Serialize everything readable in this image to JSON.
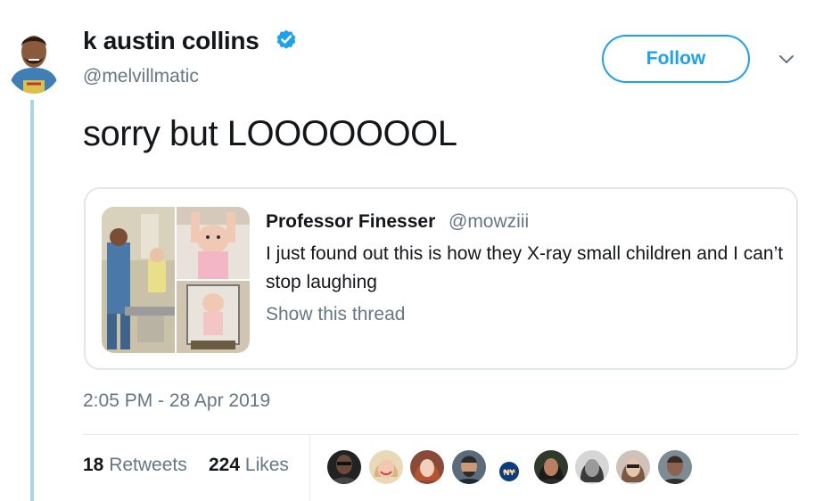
{
  "author": {
    "display_name": "k austin collins",
    "handle": "@melvillmatic",
    "verified_icon": "verified-badge-icon",
    "avatar": "avatar-illustration"
  },
  "follow_label": "Follow",
  "tweet_text": "sorry but LOOOOOOOL",
  "quoted_tweet": {
    "name": "Professor Finesser",
    "handle": "@mowziii",
    "text": "I just found out this is how they X-ray small children and I can’t stop laughing",
    "show_thread": "Show this thread"
  },
  "timestamp": "2:05 PM - 28 Apr 2019",
  "stats": {
    "retweets_count": "18",
    "retweets_label": "Retweets",
    "likes_count": "224",
    "likes_label": "Likes"
  },
  "colors": {
    "accent": "#1da1f2",
    "secondary_text": "#657786",
    "thread_line": "#a9d4eb",
    "border": "#e1e8ed"
  }
}
